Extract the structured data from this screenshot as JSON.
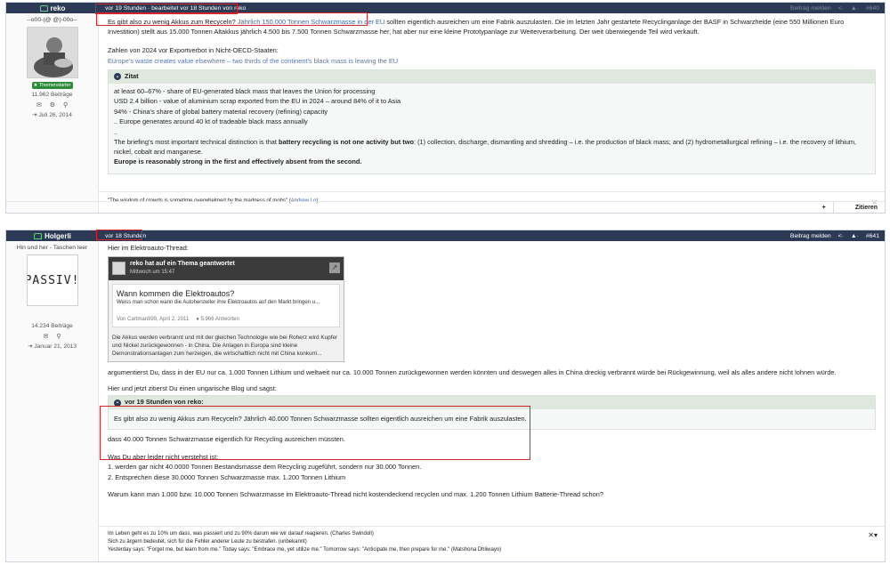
{
  "post1": {
    "author": "reko",
    "author_title": "--o00-(@ @)-00o--",
    "badge": "Themenstarter",
    "posts_count": "11.962 Beiträge",
    "joined": "Juli 26, 2014",
    "time": "vor 19 Stunden · bearbeitet vor 18 Stunden von reko",
    "report_label": "Beitrag melden",
    "number": "#640",
    "para1_start": "Es gibt also zu wenig Akkus zum Recyceln?",
    "para1_link": "Jährlich 150.000 Tonnen Schwarzmasse in der EU",
    "para1_rest": " sollten eigentlich ausreichen um eine Fabrik auszulasten. Die im letzten Jahr gestartete Recyclinganlage der BASF in Schwarzheide (eine 550 Millionen Euro Investition) stellt aus 15.000 Tonnen Altakkus jährlich 4.500 bis 7.500 Tonnen Schwarzmasse her, hat aber nur eine kleine Prototypanlage zur Weiterverarbeitung. Der weit überwiegende Teil wird verkauft.",
    "para2": "Zahlen von 2024  vor Exportverbot in Nicht-OECD-Staaten:",
    "para2_link": "Europe's waste creates value elsewhere – two thirds of the continent's black mass is leaving the EU",
    "quote_label": "Zitat",
    "quote_lines": [
      "at least 60–67% - share of EU-generated black mass that leaves the Union for processing",
      "USD 2.4 billion   - value of aluminium scrap exported from the EU in 2024 – around 84% of it to Asia",
      "94%                    - China's share of global battery material recovery (refining) capacity",
      ".. Europe generates around 40 kt of tradeable black mass annually",
      ".."
    ],
    "quote_para_start": "The briefing's most important technical distinction is that ",
    "quote_para_bold": "battery recycling is not one activity but two",
    "quote_para_rest": ": (1) collection, discharge, dismantling and shredding – i.e. the production of black mass; and (2) hydrometallurgical refining – i.e. the recovery of lithium, nickel, cobalt and manganese.",
    "quote_final": "Europe is reasonably strong in the first and effectively absent from the second.",
    "signature_text": "\"The wisdom of crowds is sometime overwhelmed by the madness of mobs\" (",
    "signature_author": "Andrew Lo",
    "signature_end": ")",
    "footer_plus": "+",
    "footer_quote": "Zitieren"
  },
  "post2": {
    "author": "Holgerli",
    "author_title": "Hin und her - Taschen leer",
    "avatar_text": "PASSIV!",
    "posts_count": "14.234 Beiträge",
    "joined": "Januar 21, 2013",
    "time": "vor 18 Stunden",
    "report_label": "Beitrag melden",
    "number": "#641",
    "intro": "Hier im Elektroauto-Thread:",
    "embed_title": "reko hat auf ein Thema geantwortet",
    "embed_date": "Mittwoch um 15:47",
    "embed_topic": "Wann kommen die Elektroautos?",
    "embed_topic_sub": "Weiss man schon wann die Autohersteller ihre Elektroautos auf den Markt bringen u...",
    "embed_meta_author": "Von Cartman999, April 2, 2011",
    "embed_meta_answers": "5.966 Antworten",
    "embed_text": "Die Akkus werden verbrannt und mit der gleichen Technologie wie bei Roherz wird Kupfer und Nickel zurückgewonnen -  in China. Die Anlagen in Europa sind kleine Demonstrationsanlagen zum herzeigen, die wirtschaftlich nicht mit China konkurri...",
    "para1": "argumentierst Du, dass in der EU nur ca. 1.000 Tonnen Lithium und weltweit nur ca. 10.000 Tonnen zurückgewonnen werden könnten und deswegen alles in China dreckig verbrannt würde bei Rückgewinnung, weil als alles andere nicht lohnen würde.",
    "para2": "Hier und jetzt zitierst Du einen ungarische Blog und sagst:",
    "quote_label": "vor 19 Stunden von reko:",
    "quote_text": "Es gibt also zu wenig Akkus zum Recyceln? Jährlich 40.000 Tonnen Schwarzmasse sollten eigentlich ausreichen um eine Fabrik auszulasten.",
    "para3": "dass 40.000 Tonnen Schwarzmasse eigentlich für Recycling ausreichen müssten.",
    "para4": "Was Du aber leider nicht verstehst ist:",
    "list": [
      "1. werden gar nicht 40.0000 Tonnen Bestandsmasse dem Recycling zugeführt, sondern nur 30.000 Tonnen.",
      "2. Entsprechen diese 30.0000 Tonnen Schwarzmasse max. 1.200 Tonnen Lithium"
    ],
    "para5": "Warum kann man 1.000 bzw. 10.000 Tonnen Schwarzmasse im Elektroauto-Thread nicht kostendeckend recyclen und max. 1.200 Tonnen Lithium Batterie-Thread schon?",
    "signature": [
      "Im Leben geht es zu 10% um dass, was passiert und zu 90% darum wie wir darauf reagieren. (Charles Swindoll)",
      "Sich zu ärgern bedeutet, sich für die Fehler anderer Leute zu bestrafen. (unbekannt)",
      "Yesterday says: \"Forget me, but learn from me.\" Today says: \"Embrace me, yet utilize me.\" Tomorrow says: \"Anticipate me, then prepare for me.\" (Matshona Dhliwayo)"
    ]
  }
}
